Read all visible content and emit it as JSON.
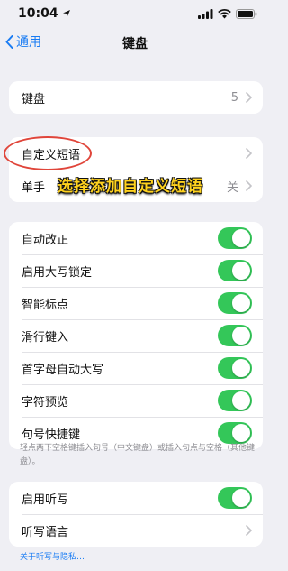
{
  "status_bar": {
    "time": "10:04"
  },
  "nav": {
    "back_label": "通用",
    "title": "键盘"
  },
  "keyboards_row": {
    "label": "键盘",
    "value": "5"
  },
  "replacement_group": {
    "text_replacement_label": "自定义短语",
    "one_handed_label": "单手",
    "one_handed_value": "关"
  },
  "overlay": {
    "caption": "选择添加自定义短语"
  },
  "toggles": [
    {
      "label": "自动改正",
      "on": true
    },
    {
      "label": "启用大写锁定",
      "on": true
    },
    {
      "label": "智能标点",
      "on": true
    },
    {
      "label": "滑行键入",
      "on": true
    },
    {
      "label": "首字母自动大写",
      "on": true
    },
    {
      "label": "字符预览",
      "on": true
    },
    {
      "label": "句号快捷键",
      "on": true
    }
  ],
  "toggles_note": "轻点两下空格键插入句号（中文键盘）或插入句点与空格（其他键盘）。",
  "dictation_group": {
    "enable_label": "启用听写",
    "enable_on": true,
    "language_label": "听写语言"
  },
  "privacy_link": "关于听写与隐私…",
  "colors": {
    "accent": "#1a7cf3",
    "toggle_on": "#34c759",
    "annotation": "#e0453a",
    "caption": "#ffd21e"
  }
}
